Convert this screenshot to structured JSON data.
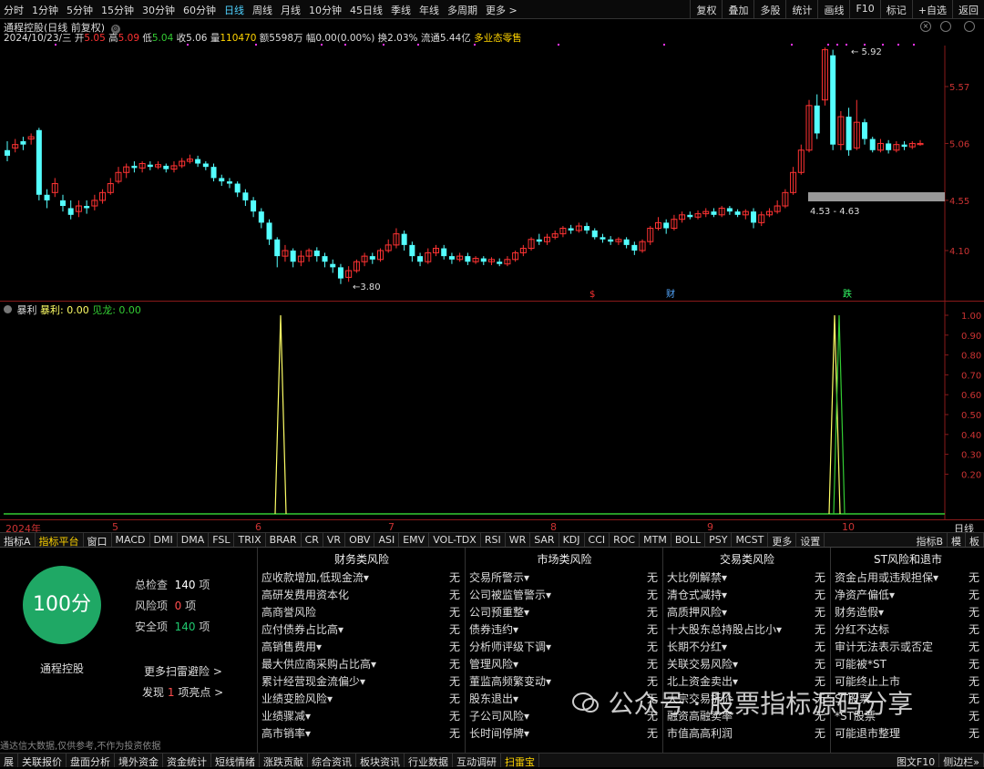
{
  "topbar": {
    "periods": [
      "分时",
      "1分钟",
      "5分钟",
      "15分钟",
      "30分钟",
      "60分钟",
      "日线",
      "周线",
      "月线",
      "10分钟",
      "45日线",
      "季线",
      "年线",
      "多周期",
      "更多 >"
    ],
    "active_period": "日线",
    "right_buttons": [
      "复权",
      "叠加",
      "多股",
      "统计",
      "画线",
      "F10",
      "标记",
      "+自选",
      "返回"
    ]
  },
  "stock": {
    "title": "通程控股(日线 前复权)",
    "date": "2024/10/23/三",
    "open_label": "开",
    "open": "5.05",
    "high_label": "高",
    "high": "5.09",
    "low_label": "低",
    "low": "5.04",
    "close_label": "收",
    "close": "5.06",
    "vol_label": "量",
    "vol": "110470",
    "amount_label": "额",
    "amount": "5598万",
    "change_label": "幅",
    "change": "0.00(0.00%)",
    "turnover_label": "换",
    "turnover": "2.03%",
    "float_label": "流通",
    "float": "5.44亿",
    "sector": "多业态零售"
  },
  "price_axis": [
    "5.57",
    "5.06",
    "4.55",
    "4.10"
  ],
  "annotations": {
    "high_label": "5.92",
    "low_label": "3.80",
    "zone_label": "4.53 - 4.63",
    "markers": [
      "$",
      "财",
      "跌"
    ]
  },
  "indicator": {
    "name": "暴利",
    "line1_label": "暴利: 0.00",
    "line2_label": "见龙: 0.00",
    "axis": [
      "1.00",
      "0.90",
      "0.80",
      "0.70",
      "0.60",
      "0.50",
      "0.40",
      "0.30",
      "0.20"
    ]
  },
  "xaxis": {
    "labels": [
      "2024年",
      "5",
      "6",
      "7",
      "8",
      "9",
      "10"
    ],
    "right": "日线"
  },
  "indicator_tabs": [
    "指标A",
    "指标平台",
    "窗口",
    "MACD",
    "DMI",
    "DMA",
    "FSL",
    "TRIX",
    "BRAR",
    "CR",
    "VR",
    "OBV",
    "ASI",
    "EMV",
    "VOL-TDX",
    "RSI",
    "WR",
    "SAR",
    "KDJ",
    "CCI",
    "ROC",
    "MTM",
    "BOLL",
    "PSY",
    "MCST",
    "更多",
    "设置"
  ],
  "indicator_tabs_right": [
    "指标B",
    "模",
    "板"
  ],
  "risk": {
    "score": "100分",
    "stock_name": "通程控股",
    "total_label": "总检查",
    "total": "140",
    "unit": "项",
    "risk_label": "风险项",
    "risk_count": "0",
    "safe_label": "安全项",
    "safe_count": "140",
    "more_link": "更多扫雷避险 >",
    "found_prefix": "发现",
    "found_count": "1",
    "found_suffix": "项亮点 >",
    "disclaimer": "通达信大数据,仅供参考,不作为投资依据",
    "columns": [
      {
        "title": "财务类风险",
        "items": [
          "应收款增加,低现金流▾",
          "高研发费用资本化",
          "高商誉风险",
          "应付债券占比高▾",
          "高销售费用▾",
          "最大供应商采购占比高▾",
          "累计经营现金流偏少▾",
          "业绩变脸风险▾",
          "业绩骤减▾",
          "高市销率▾"
        ]
      },
      {
        "title": "市场类风险",
        "items": [
          "交易所警示▾",
          "公司被监管警示▾",
          "公司预重整▾",
          "债券违约▾",
          "分析师评级下调▾",
          "管理风险▾",
          "董监高频繁变动▾",
          "股东退出▾",
          "子公司风险▾",
          "长时间停牌▾"
        ]
      },
      {
        "title": "交易类风险",
        "items": [
          "大比例解禁▾",
          "清仓式减持▾",
          "高质押风险▾",
          "十大股东总持股占比小▾",
          "长期不分红▾",
          "关联交易风险▾",
          "北上资金卖出▾",
          "大宗交易折价",
          "融资高融卖率",
          "市值高高利润"
        ]
      },
      {
        "title": "ST风险和退市",
        "items": [
          "资金占用或违规担保▾",
          "净资产偏低▾",
          "财务造假▾",
          "分红不达标",
          "审计无法表示或否定",
          "可能被*ST",
          "可能终止上市",
          "ST股票",
          "*ST股票",
          "可能退市整理"
        ]
      }
    ],
    "value": "无"
  },
  "bottombar": [
    "展",
    "关联报价",
    "盘面分析",
    "境外资金",
    "资金统计",
    "短线情绪",
    "涨跌贡献",
    "综合资讯",
    "板块资讯",
    "行业数据",
    "互动调研",
    "扫雷宝"
  ],
  "bottombar_active": "扫雷宝",
  "bottombar_right": [
    "图文F10",
    "侧边栏»"
  ],
  "watermark": "公众号 · 股票指标源码分享",
  "colors": {
    "up": "#ff3333",
    "down": "#54ffff",
    "indicator1": "#ffff66",
    "indicator2": "#33cc33",
    "score": "#1fa865"
  }
}
